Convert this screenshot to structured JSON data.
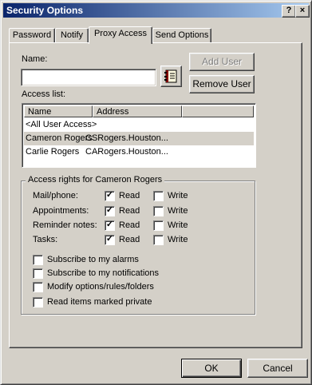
{
  "window": {
    "title": "Security Options",
    "help_glyph": "?",
    "close_glyph": "×"
  },
  "tabs": [
    "Password",
    "Notify",
    "Proxy Access",
    "Send Options"
  ],
  "active_tab": "Proxy Access",
  "name_label": "Name:",
  "name_value": "",
  "address_book_icon": "address-book-icon",
  "add_user_label": "Add User",
  "remove_user_label": "Remove User",
  "access_list": {
    "label": "Access list:",
    "columns": [
      "Name",
      "Address"
    ],
    "rows": [
      {
        "name": "<All User Access>",
        "address": ""
      },
      {
        "name": "Cameron Rogers",
        "address": "CSRogers.Houston..."
      },
      {
        "name": "Carlie Rogers",
        "address": "CARogers.Houston..."
      }
    ],
    "selected_row": "Cameron Rogers"
  },
  "rights": {
    "group_title": "Access rights for Cameron Rogers",
    "categories": [
      {
        "label": "Mail/phone:",
        "read_label": "Read",
        "read": true,
        "write_label": "Write",
        "write": false
      },
      {
        "label": "Appointments:",
        "read_label": "Read",
        "read": true,
        "write_label": "Write",
        "write": false
      },
      {
        "label": "Reminder notes:",
        "read_label": "Read",
        "read": true,
        "write_label": "Write",
        "write": false
      },
      {
        "label": "Tasks:",
        "read_label": "Read",
        "read": true,
        "write_label": "Write",
        "write": false
      }
    ],
    "options": [
      {
        "label": "Subscribe to my alarms",
        "checked": false
      },
      {
        "label": "Subscribe to my notifications",
        "checked": false
      },
      {
        "label": "Modify options/rules/folders",
        "checked": false
      },
      {
        "label": "Read items marked private",
        "checked": false
      }
    ]
  },
  "check_glyph": "✓",
  "ok_label": "OK",
  "cancel_label": "Cancel",
  "colors": {
    "title_start": "#0a246a",
    "title_end": "#a6caf0",
    "face": "#d4d0c8"
  }
}
